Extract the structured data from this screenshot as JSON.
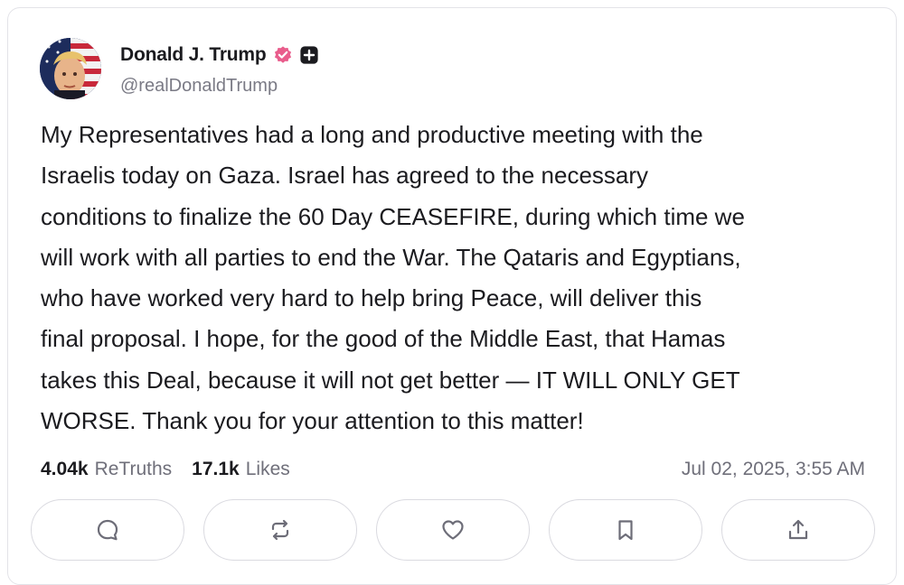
{
  "post": {
    "author": {
      "display_name": "Donald J. Trump",
      "handle": "@realDonaldTrump",
      "verified_color": "#e95d8c",
      "icons": [
        "verified-badge-icon",
        "plus-icon"
      ]
    },
    "text": "My Representatives had a long and productive meeting with the\nIsraelis today on Gaza. Israel has agreed to the necessary\nconditions to finalize the 60 Day CEASEFIRE, during which time we\nwill work with all parties to end the War. The Qataris and Egyptians,\nwho have worked very hard to help bring Peace, will deliver this\nfinal proposal. I hope, for the good of the Middle East, that Hamas\ntakes this Deal, because it will not get better — IT WILL ONLY GET\nWORSE. Thank you for your attention to this matter!",
    "stats": {
      "retruths_count": "4.04k",
      "retruths_label": "ReTruths",
      "likes_count": "17.1k",
      "likes_label": "Likes"
    },
    "timestamp": "Jul 02, 2025, 3:55 AM"
  },
  "actions": [
    {
      "name": "reply",
      "icon": "reply-icon"
    },
    {
      "name": "retruth",
      "icon": "retruth-icon"
    },
    {
      "name": "like",
      "icon": "heart-icon"
    },
    {
      "name": "bookmark",
      "icon": "bookmark-icon"
    },
    {
      "name": "share",
      "icon": "share-icon"
    }
  ],
  "colors": {
    "text": "#1b1b1f",
    "muted": "#6f6f7a",
    "border": "#dadae0",
    "icon": "#6d6d78"
  }
}
